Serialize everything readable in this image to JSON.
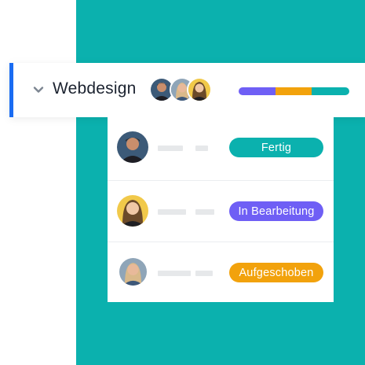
{
  "project": {
    "title": "Webdesign",
    "progress_segments": [
      {
        "name": "purple",
        "color": "#6f5ff5",
        "fraction": 0.33
      },
      {
        "name": "orange",
        "color": "#f2a20c",
        "fraction": 0.33
      },
      {
        "name": "teal",
        "color": "#0bb1ae",
        "fraction": 0.34
      }
    ]
  },
  "tasks": [
    {
      "status": "Fertig",
      "status_color": "#0bb1ae"
    },
    {
      "status": "In Bearbeitung",
      "status_color": "#6f5ff5"
    },
    {
      "status": "Aufgeschoben",
      "status_color": "#f2a20c"
    }
  ],
  "colors": {
    "accent": "#1a6cf2",
    "background": "#0bb1ae"
  }
}
